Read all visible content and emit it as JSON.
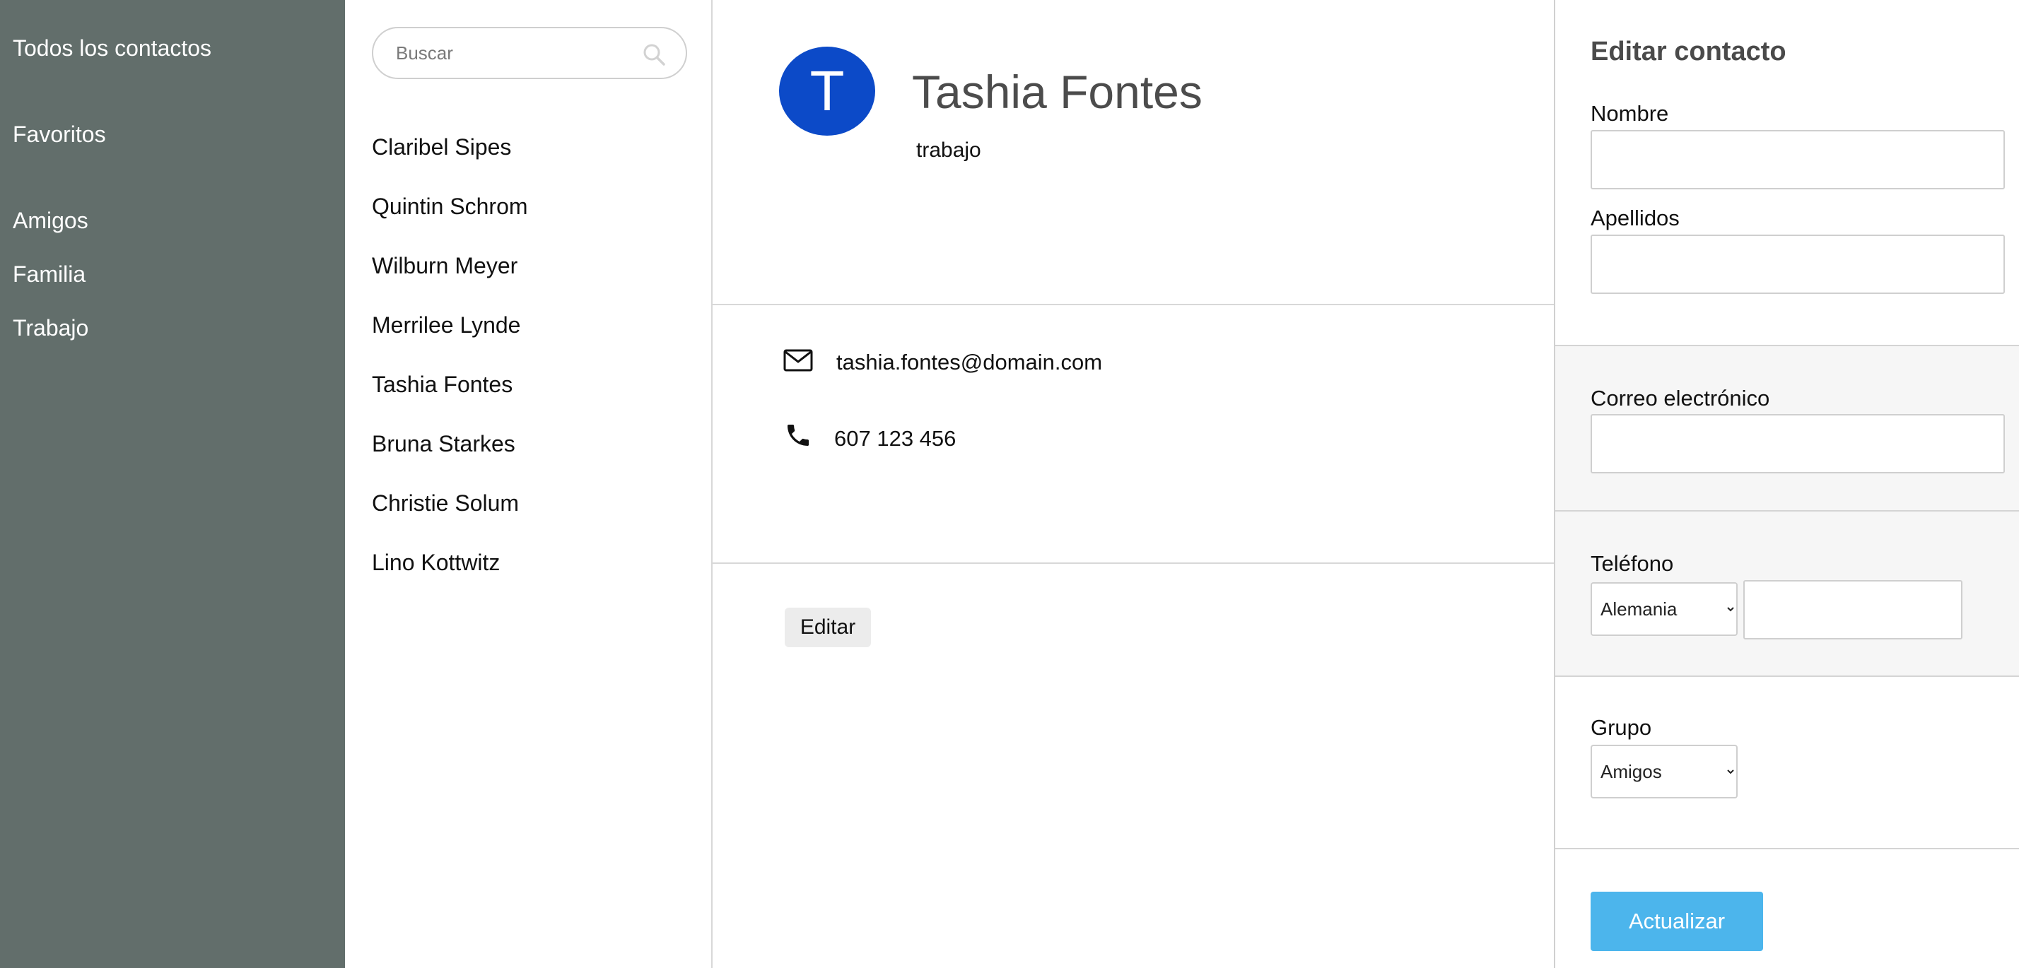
{
  "sidebar": {
    "groups": [
      {
        "label": "Todos los contactos"
      },
      {
        "label": "Favoritos"
      },
      {
        "label": "Amigos"
      },
      {
        "label": "Familia"
      },
      {
        "label": "Trabajo"
      }
    ]
  },
  "search": {
    "placeholder": "Buscar",
    "value": ""
  },
  "contacts": [
    {
      "name": "Claribel Sipes"
    },
    {
      "name": "Quintin Schrom"
    },
    {
      "name": "Wilburn Meyer"
    },
    {
      "name": "Merrilee Lynde"
    },
    {
      "name": "Tashia Fontes"
    },
    {
      "name": "Bruna Starkes"
    },
    {
      "name": "Christie Solum"
    },
    {
      "name": "Lino Kottwitz"
    }
  ],
  "detail": {
    "avatar_initial": "T",
    "name": "Tashia Fontes",
    "group": "trabajo",
    "email": "tashia.fontes@domain.com",
    "phone": "607 123 456",
    "edit_label": "Editar"
  },
  "edit_panel": {
    "title": "Editar contacto",
    "first_name_label": "Nombre",
    "first_name_value": "",
    "last_name_label": "Apellidos",
    "last_name_value": "",
    "email_label": "Correo electrónico",
    "email_value": "",
    "phone_label": "Teléfono",
    "phone_country": "Alemania",
    "phone_value": "",
    "group_label": "Grupo",
    "group_value": "Amigos",
    "update_label": "Actualizar"
  },
  "colors": {
    "sidebar_bg": "#626e6b",
    "avatar_bg": "#0c4ac8",
    "update_button": "#4cb5ec",
    "section_alt_bg": "#f6f6f6"
  },
  "icons": {
    "search": "search-icon",
    "email": "envelope-icon",
    "phone": "phone-icon",
    "dropdown": "chevron-down-icon"
  }
}
